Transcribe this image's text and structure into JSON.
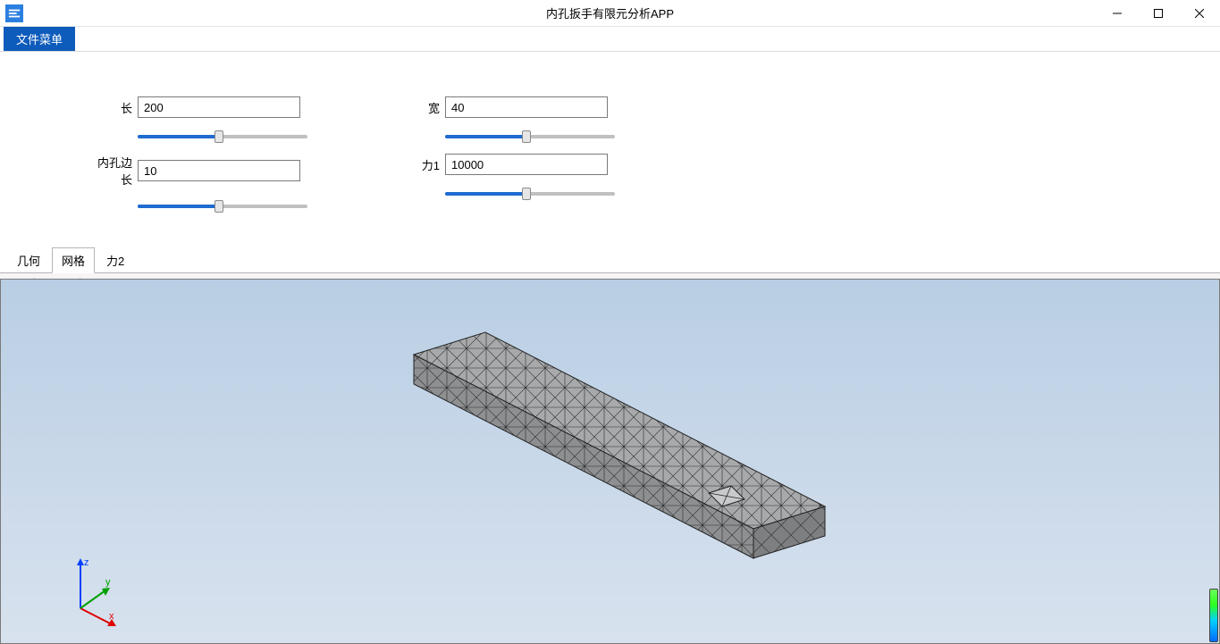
{
  "app": {
    "title": "内孔扳手有限元分析APP"
  },
  "menu": {
    "file": "文件菜单"
  },
  "params": {
    "length": {
      "label": "长",
      "value": "200",
      "pct": 48
    },
    "width": {
      "label": "宽",
      "value": "40",
      "pct": 48
    },
    "holeEdge": {
      "label": "内孔边长",
      "value": "10",
      "pct": 48
    },
    "force1": {
      "label": "力1",
      "value": "10000",
      "pct": 48
    }
  },
  "tabs": {
    "geometry": "几何",
    "mesh": "网格",
    "force2": "力2"
  },
  "axes": {
    "x": "x",
    "y": "y",
    "z": "z"
  }
}
